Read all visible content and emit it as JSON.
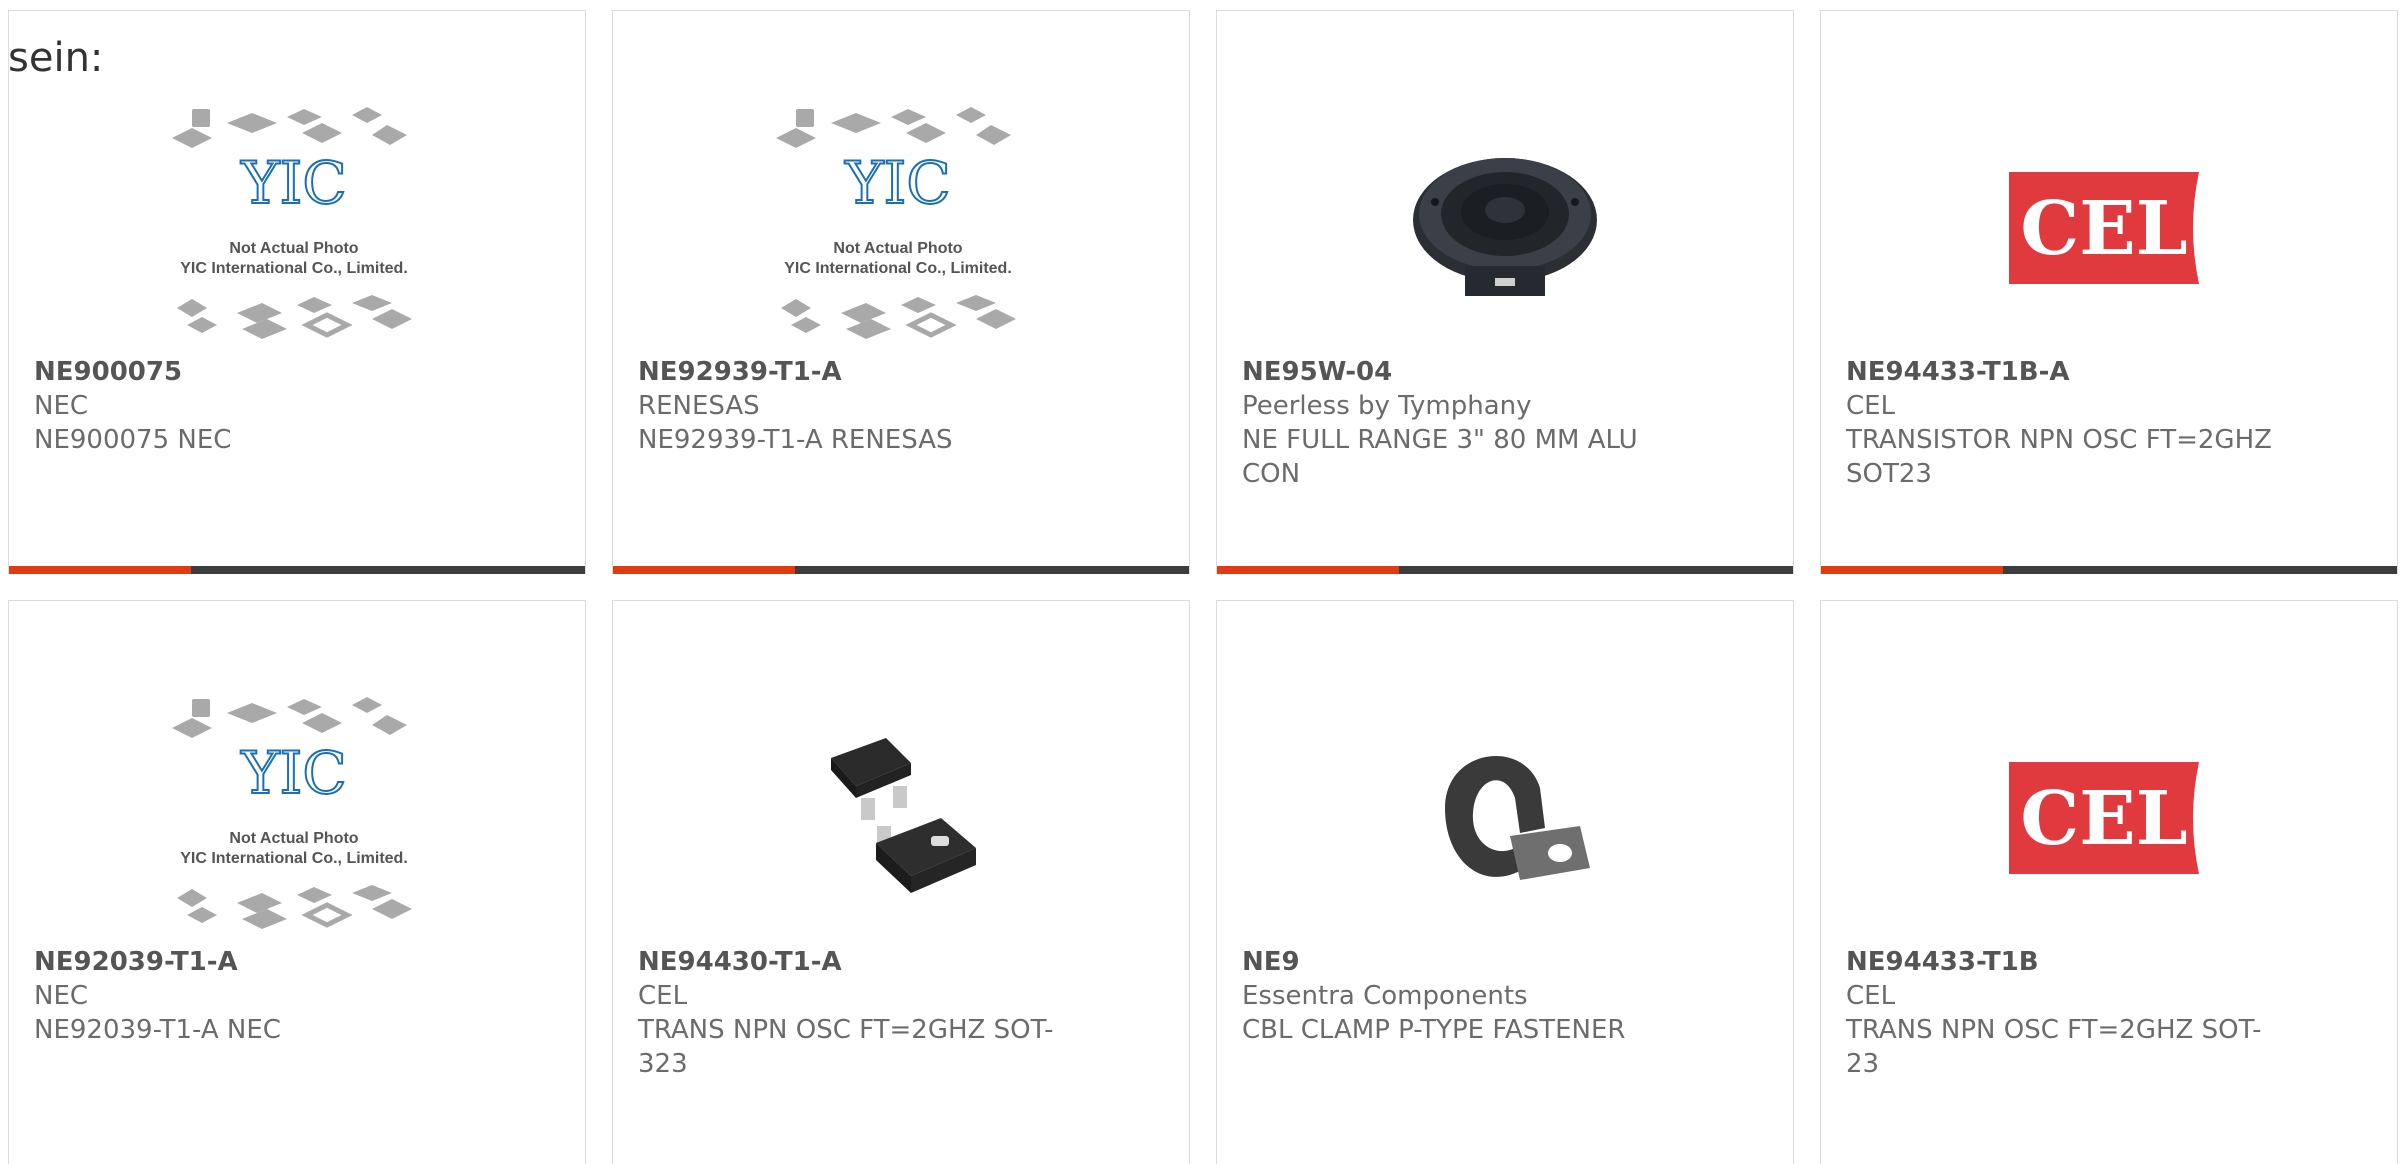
{
  "intro_text": "sein:",
  "placeholder_caption": {
    "line1": "Not Actual Photo",
    "line2": "YIC International Co., Limited."
  },
  "yic_logo_text": "YIC",
  "cel_logo_text": "CEL",
  "products": [
    {
      "part_number": "NE900075",
      "manufacturer": "NEC",
      "description": "NE900075 NEC",
      "image": "yic-placeholder"
    },
    {
      "part_number": "NE92939-T1-A",
      "manufacturer": "RENESAS",
      "description": "NE92939-T1-A RENESAS",
      "image": "yic-placeholder"
    },
    {
      "part_number": "NE95W-04",
      "manufacturer": "Peerless by Tymphany",
      "description": "NE FULL RANGE 3\" 80 MM ALU CON",
      "image": "speaker-photo"
    },
    {
      "part_number": "NE94433-T1B-A",
      "manufacturer": "CEL",
      "description": "TRANSISTOR NPN OSC FT=2GHZ SOT23",
      "image": "cel-logo"
    },
    {
      "part_number": "NE92039-T1-A",
      "manufacturer": "NEC",
      "description": "NE92039-T1-A NEC",
      "image": "yic-placeholder"
    },
    {
      "part_number": "NE94430-T1-A",
      "manufacturer": "CEL",
      "description": "TRANS NPN OSC FT=2GHZ SOT-323",
      "image": "sot323-photo"
    },
    {
      "part_number": "NE9",
      "manufacturer": "Essentra Components",
      "description": "CBL CLAMP P-TYPE FASTENER",
      "image": "cable-clamp-photo"
    },
    {
      "part_number": "NE94433-T1B",
      "manufacturer": "CEL",
      "description": "TRANS NPN OSC FT=2GHZ SOT-23",
      "image": "cel-logo"
    }
  ],
  "colors": {
    "accent": "#e23b12",
    "bar": "#3d3d3d",
    "cel_red": "#e03a3e",
    "yic_blue": "#1a6fb5"
  }
}
